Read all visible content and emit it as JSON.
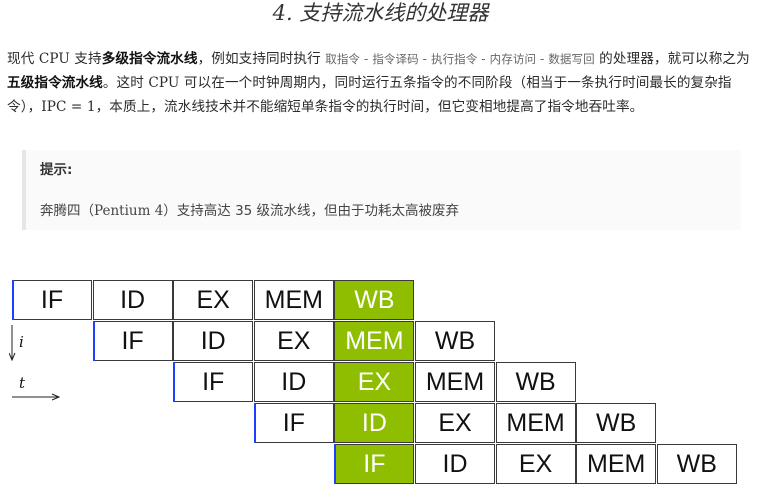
{
  "title": "4. 支持流水线的处理器",
  "paragraph": {
    "t1": "现代 ",
    "cpu1": "CPU",
    "t2": " 支持",
    "b1": "多级指令流水线",
    "t3": "，例如支持同时执行 ",
    "stage1": "取指令",
    "sep": " - ",
    "stage2": "指令译码",
    "stage3": "执行指令",
    "stage4": "内存访问",
    "stage5": "数据写回",
    "t4": " 的处理器，就可以称之为",
    "b2": "五级指令流水线",
    "t5": "。这时 ",
    "cpu2": "CPU",
    "t6": " 可以在一个时钟周期内，同时运行五条指令的不同阶段（相当于一条执行时间最长的复杂指令），",
    "ipc": "IPC = 1",
    "t7": "，本质上，流水线技术并不能缩短单条指令的执行时间，但它变相地提高了指令地吞吐率。"
  },
  "tip": {
    "title": "提示:",
    "t1": "奔腾四（",
    "latin": "Pentium 4",
    "t2": "）支持高达 35 级流水线，但由于功耗太高被废弃"
  },
  "axis": {
    "i": "i",
    "t": "t"
  },
  "pipeline": {
    "rows": [
      [
        "IF",
        "ID",
        "EX",
        "MEM",
        "WB"
      ],
      [
        "IF",
        "ID",
        "EX",
        "MEM",
        "WB"
      ],
      [
        "IF",
        "ID",
        "EX",
        "MEM",
        "WB"
      ],
      [
        "IF",
        "ID",
        "EX",
        "MEM",
        "WB"
      ],
      [
        "IF",
        "ID",
        "EX",
        "MEM",
        "WB"
      ]
    ],
    "highlight_column": 4,
    "highlight_color": "#8fbe00",
    "marker_color": "#1f3fff"
  }
}
